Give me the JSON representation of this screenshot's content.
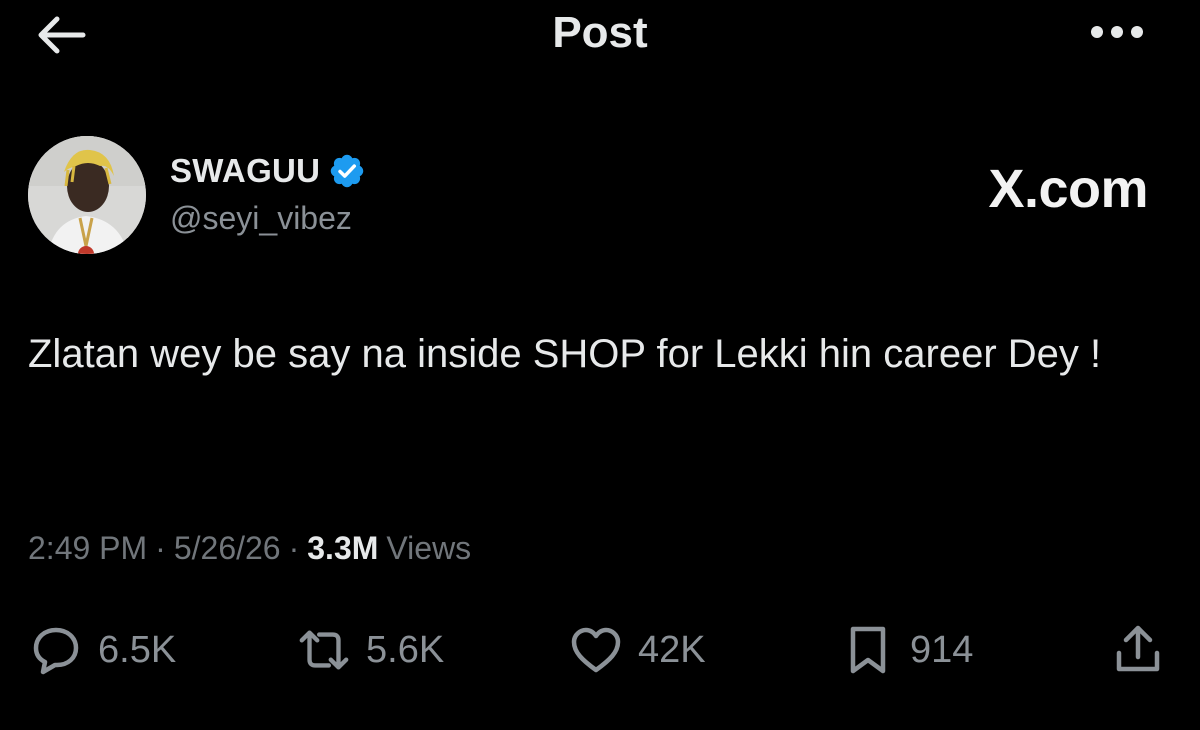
{
  "header": {
    "title": "Post",
    "back_icon": "arrow-left-icon",
    "more_icon": "more-horizontal-icon"
  },
  "author": {
    "display_name": "SWAGUU",
    "handle": "@seyi_vibez",
    "verified": true,
    "verified_color": "#1d9bf0"
  },
  "brand": "X.com",
  "post": {
    "text": "Zlatan wey be say na inside SHOP for Lekki hin career Dey !",
    "time": "2:49 PM",
    "separator": "·",
    "date": "5/26/26",
    "views_count": "3.3M",
    "views_label": "Views"
  },
  "actions": {
    "replies": "6.5K",
    "reposts": "5.6K",
    "likes": "42K",
    "bookmarks": "914"
  }
}
